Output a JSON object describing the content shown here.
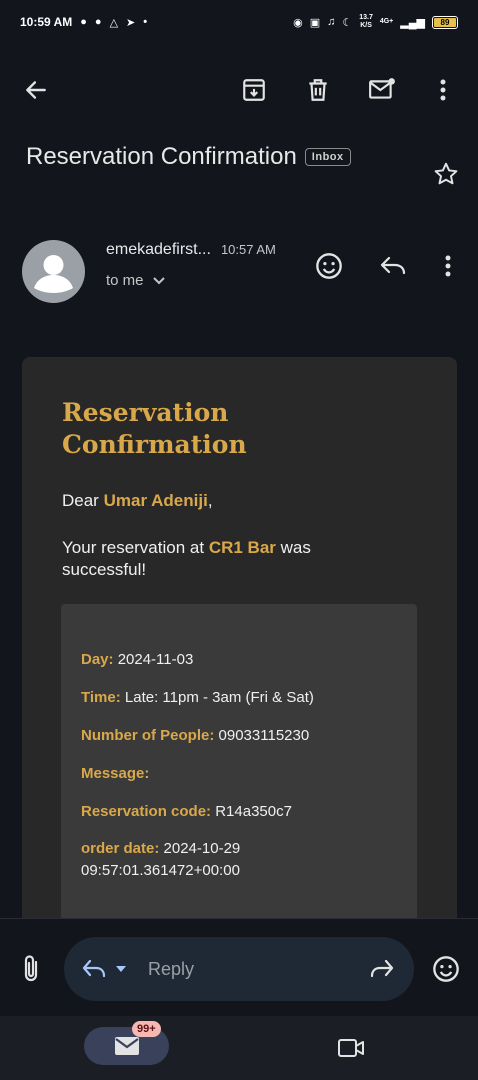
{
  "status_bar": {
    "time": "10:59 AM",
    "speed_top": "13.7",
    "speed_bottom": "K/S",
    "network": "4G+",
    "battery": "89"
  },
  "email": {
    "subject": "Reservation Confirmation",
    "label": "Inbox",
    "sender": "emekadefirst...",
    "time": "10:57 AM",
    "recipient": "to me"
  },
  "body": {
    "heading": "Reservation Confirmation",
    "greeting": "Dear",
    "name": "Umar Adeniji",
    "name_suffix": ",",
    "message_prefix": "Your reservation at",
    "venue": "CR1 Bar",
    "message_suffix": "was successful!",
    "details": [
      {
        "key": "Day:",
        "value": "2024-11-03"
      },
      {
        "key": "Time:",
        "value": "Late: 11pm - 3am (Fri & Sat)"
      },
      {
        "key": "Number of People:",
        "value": "09033115230"
      },
      {
        "key": "Message:",
        "value": ""
      },
      {
        "key": "Reservation code:",
        "value": "R14a350c7"
      },
      {
        "key": "order date:",
        "value": "2024-10-29 09:57:01.361472+00:00"
      }
    ]
  },
  "reply_bar": {
    "reply_label": "Reply"
  },
  "bottom_nav": {
    "mail_badge": "99+"
  },
  "icons": {
    "back": "arrow-left-icon",
    "archive": "archive-icon",
    "delete": "trash-icon",
    "mark_unread": "mail-unread-icon",
    "more": "more-vert-icon",
    "star": "star-icon",
    "emoji": "emoji-icon",
    "reply": "reply-icon",
    "attach": "attachment-icon",
    "forward": "forward-icon",
    "mail": "mail-icon",
    "meet": "video-icon"
  },
  "colors": {
    "background": "#12151c",
    "card": "#282828",
    "accent_gold": "#d9a84a",
    "badge": "#f6b8b3"
  }
}
